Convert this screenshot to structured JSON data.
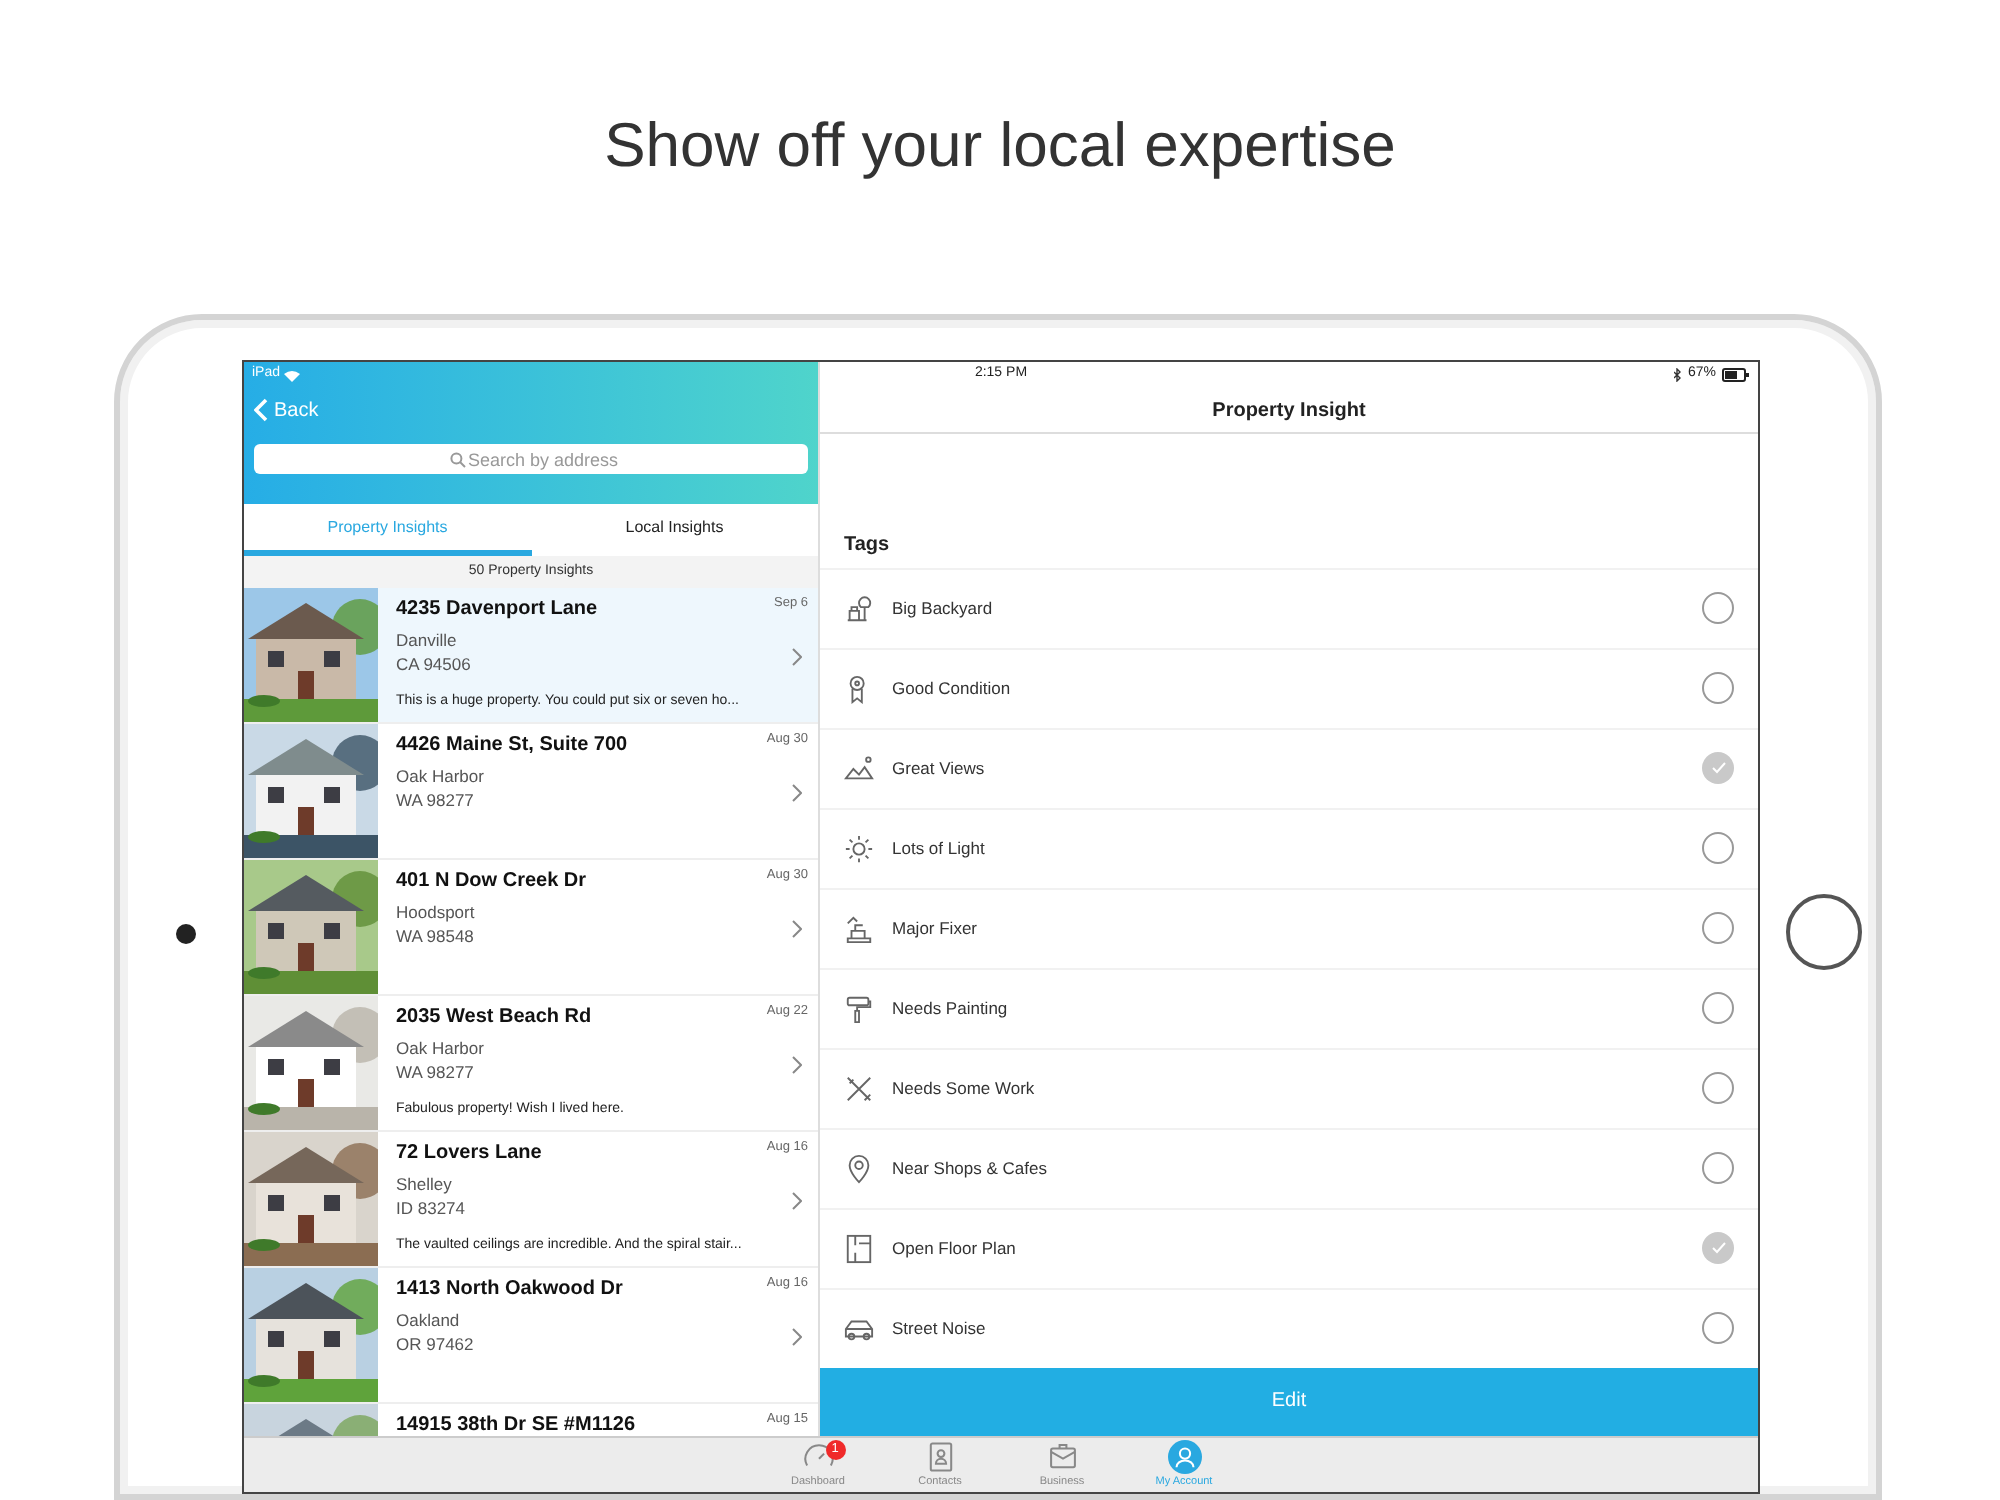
{
  "headline": "Show off your local expertise",
  "status_bar": {
    "device": "iPad",
    "time": "2:15 PM",
    "battery": "67%"
  },
  "left_panel": {
    "back": "Back",
    "search": {
      "placeholder": "Search by address"
    },
    "tabs": [
      {
        "label": "Property Insights",
        "selected": true
      },
      {
        "label": "Local Insights",
        "selected": false
      }
    ],
    "count": "50 Property Insights",
    "properties": [
      {
        "title": "4235 Davenport Lane",
        "city": "Danville",
        "region": "CA 94506",
        "note": "This is a huge property. You could put six or seven ho...",
        "date": "Sep 6",
        "selected": true
      },
      {
        "title": "4426 Maine St, Suite 700",
        "city": "Oak Harbor",
        "region": "WA 98277",
        "date": "Aug 30",
        "selected": false
      },
      {
        "title": "401 N Dow Creek Dr",
        "city": "Hoodsport",
        "region": "WA 98548",
        "date": "Aug 30",
        "selected": false
      },
      {
        "title": "2035 West Beach Rd",
        "city": "Oak Harbor",
        "region": "WA 98277",
        "note": "Fabulous property!  Wish I lived here.",
        "date": "Aug 22",
        "selected": false
      },
      {
        "title": "72 Lovers Lane",
        "city": "Shelley",
        "region": "ID 83274",
        "note": "The vaulted ceilings are incredible. And the spiral stair...",
        "date": "Aug 16",
        "selected": false
      },
      {
        "title": "1413 North Oakwood Dr",
        "city": "Oakland",
        "region": "OR 97462",
        "date": "Aug 16",
        "selected": false
      },
      {
        "title": "14915 38th Dr SE #M1126",
        "date": "Aug 15",
        "selected": false
      }
    ]
  },
  "right_panel": {
    "title": "Property Insight",
    "section": "Tags",
    "tags": [
      {
        "label": "Big Backyard",
        "checked": false
      },
      {
        "label": "Good Condition",
        "checked": false
      },
      {
        "label": "Great Views",
        "checked": true
      },
      {
        "label": "Lots of Light",
        "checked": false
      },
      {
        "label": "Major Fixer",
        "checked": false
      },
      {
        "label": "Needs Painting",
        "checked": false
      },
      {
        "label": "Needs Some Work",
        "checked": false
      },
      {
        "label": "Near Shops & Cafes",
        "checked": false
      },
      {
        "label": "Open Floor Plan",
        "checked": true
      },
      {
        "label": "Street Noise",
        "checked": false
      }
    ],
    "button": "Edit"
  },
  "tab_bar": [
    {
      "label": "Dashboard",
      "badge": "1",
      "selected": false
    },
    {
      "label": "Contacts",
      "selected": false
    },
    {
      "label": "Business",
      "selected": false
    },
    {
      "label": "My Account",
      "selected": true
    }
  ]
}
